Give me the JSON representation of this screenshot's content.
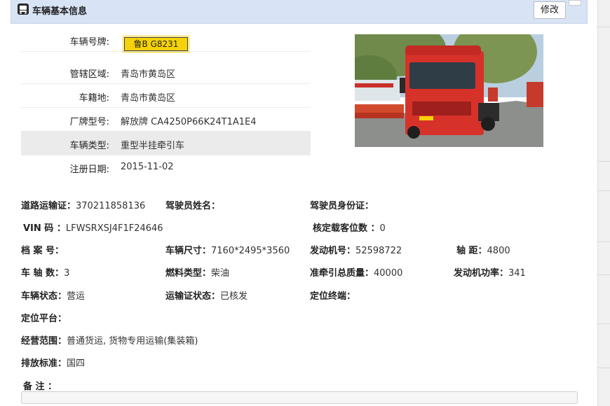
{
  "header": {
    "title": "车辆基本信息",
    "edit_label": "修改"
  },
  "basic": [
    {
      "label": "车辆号牌:",
      "value": ""
    },
    {
      "label": "管辖区域:",
      "value": "青岛市黄岛区"
    },
    {
      "label": "车籍地:",
      "value": "青岛市黄岛区"
    },
    {
      "label": "厂牌型号:",
      "value": "解放牌 CA4250P66K24T1A1E4"
    },
    {
      "label": "车辆类型:",
      "value": "重型半挂牵引车"
    },
    {
      "label": "注册日期:",
      "value": "2015-11-02"
    }
  ],
  "plate": "鲁B G8231",
  "details": {
    "road_permit": {
      "label": "道路运输证：",
      "value": "370211858136"
    },
    "driver_name": {
      "label": "驾驶员姓名：",
      "value": ""
    },
    "driver_id": {
      "label": "驾驶员身份证：",
      "value": ""
    },
    "vin": {
      "label": "VIN 码 ：",
      "value": "LFWSRXSJ4F1F24646"
    },
    "seats": {
      "label": "核定载客位数 ：",
      "value": "0"
    },
    "archive_no": {
      "label": "档 案 号：",
      "value": ""
    },
    "dimensions": {
      "label": "车辆尺寸：",
      "value": "7160*2495*3560"
    },
    "engine_no": {
      "label": "发动机号：",
      "value": "52598722"
    },
    "wheelbase": {
      "label": "轴 距：",
      "value": "4800"
    },
    "axles": {
      "label": "车 轴 数：",
      "value": "3"
    },
    "fuel": {
      "label": "燃料类型：",
      "value": "柴油"
    },
    "tow_mass": {
      "label": "准牵引总质量：",
      "value": "40000"
    },
    "engine_power": {
      "label": "发动机功率：",
      "value": "341"
    },
    "vehicle_status": {
      "label": "车辆状态：",
      "value": "营运"
    },
    "permit_status": {
      "label": "运输证状态：",
      "value": "已核发"
    },
    "gps_terminal": {
      "label": "定位终端：",
      "value": ""
    },
    "gps_platform": {
      "label": "定位平台：",
      "value": ""
    },
    "business_scope": {
      "label": "经营范围：",
      "value": "普通货运, 货物专用运输(集装箱)"
    },
    "emission": {
      "label": "排放标准：",
      "value": "国四"
    },
    "remark": {
      "label": "备 注 ：",
      "value": ""
    }
  },
  "colors": {
    "header_bg": "#d8e4f6",
    "plate_yellow": "#f5d20a",
    "highlight_row": "#ebebeb"
  },
  "icons": {
    "header": "truck-icon"
  }
}
